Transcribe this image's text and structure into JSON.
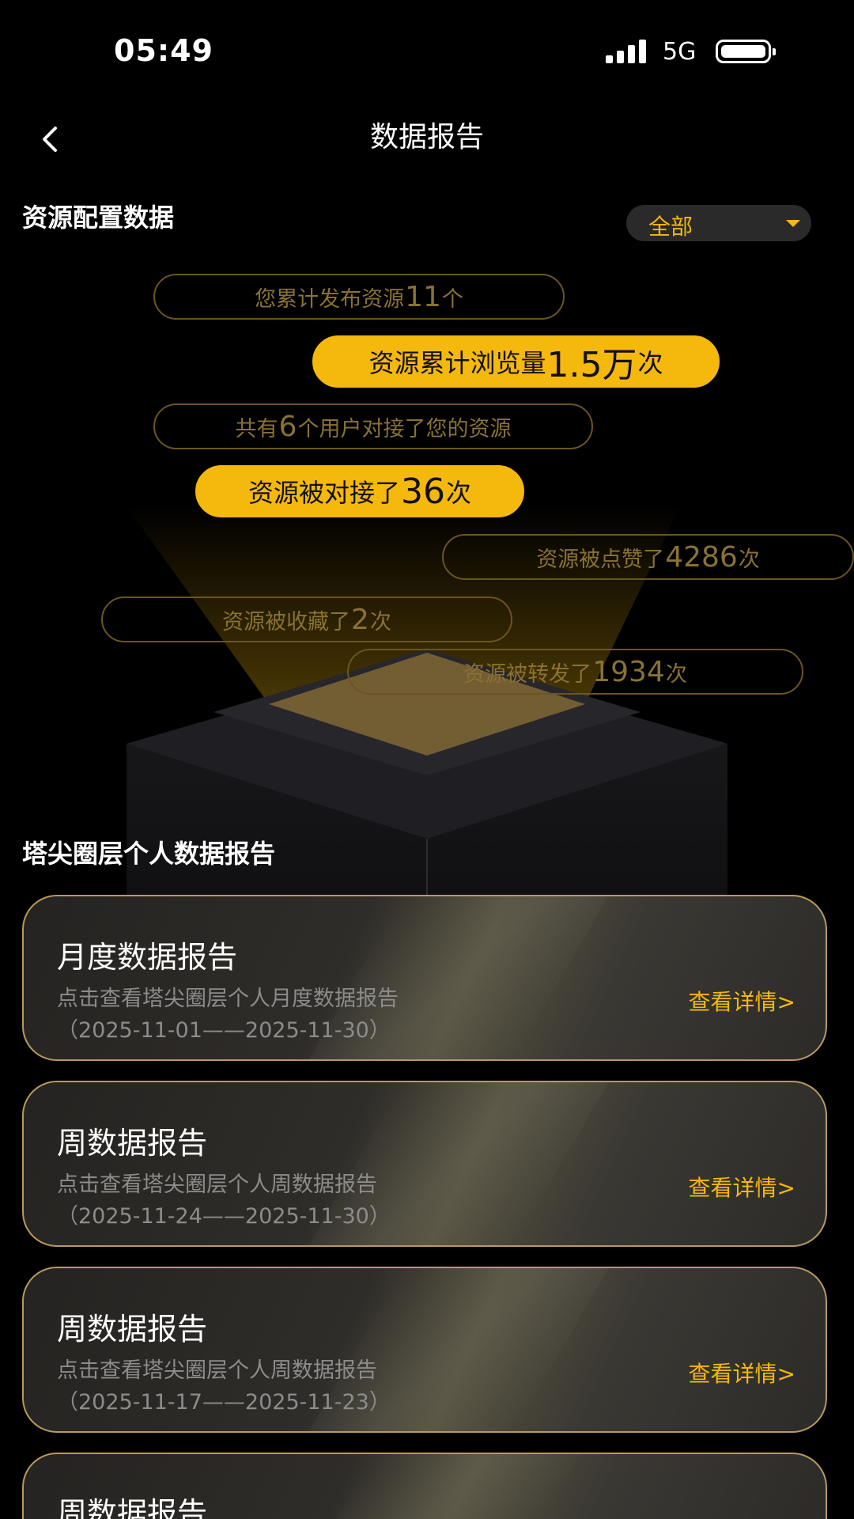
{
  "status": {
    "time": "05:49",
    "network": "5G"
  },
  "nav": {
    "title": "数据报告"
  },
  "resource": {
    "title": "资源配置数据",
    "filter": "全部",
    "stats": [
      {
        "prefix": "您累计发布资源",
        "num": "11",
        "suffix": "个",
        "highlight": false
      },
      {
        "prefix": "资源累计浏览量",
        "num": "1.5万",
        "suffix": "次",
        "highlight": true
      },
      {
        "prefix": "共有",
        "num": "6",
        "suffix": "个用户对接了您的资源",
        "highlight": false
      },
      {
        "prefix": "资源被对接了",
        "num": "36",
        "suffix": "次",
        "highlight": true
      },
      {
        "prefix": "资源被点赞了",
        "num": "4286",
        "suffix": "次",
        "highlight": false
      },
      {
        "prefix": "资源被收藏了",
        "num": "2",
        "suffix": "次",
        "highlight": false
      },
      {
        "prefix": "资源被转发了",
        "num": "1934",
        "suffix": "次",
        "highlight": false
      }
    ]
  },
  "reports": {
    "title": "塔尖圈层个人数据报告",
    "link_label": "查看详情>",
    "items": [
      {
        "title": "月度数据报告",
        "desc": "点击查看塔尖圈层个人月度数据报告",
        "range": "（2025-11-01——2025-11-30）"
      },
      {
        "title": "周数据报告",
        "desc": "点击查看塔尖圈层个人周数据报告",
        "range": "（2025-11-24——2025-11-30）"
      },
      {
        "title": "周数据报告",
        "desc": "点击查看塔尖圈层个人周数据报告",
        "range": "（2025-11-17——2025-11-23）"
      },
      {
        "title": "周数据报告",
        "desc": "",
        "range": ""
      }
    ]
  },
  "colors": {
    "accent": "#f5b80d",
    "background": "#000000",
    "card_border": "#b89a5b"
  }
}
